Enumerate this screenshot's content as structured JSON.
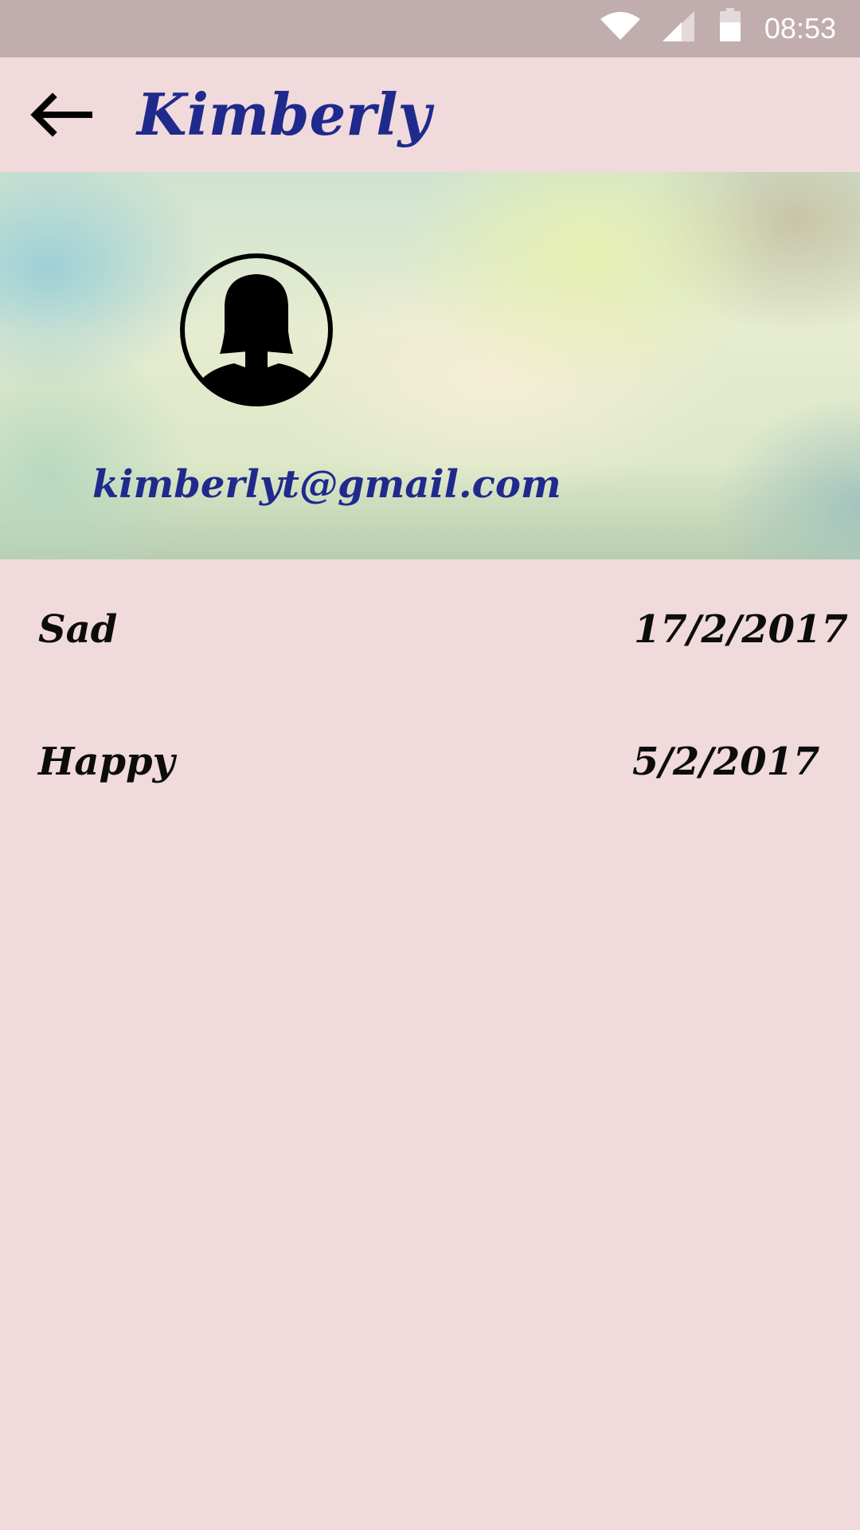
{
  "status_bar": {
    "time": "08:53",
    "icons": [
      "wifi-icon",
      "signal-icon",
      "battery-icon"
    ]
  },
  "app_bar": {
    "back_icon": "arrow-left-icon",
    "title": "Kimberly"
  },
  "profile": {
    "avatar_icon": "female-avatar-icon",
    "email": "kimberlyt@gmail.com"
  },
  "moods": [
    {
      "mood": "Sad",
      "date": "17/2/2017"
    },
    {
      "mood": "Happy",
      "date": "5/2/2017"
    }
  ],
  "colors": {
    "background": "#f0dadb",
    "status_bar": "#c1adad",
    "accent_text": "#1f2a8c",
    "body_text": "#0c0c0c"
  }
}
